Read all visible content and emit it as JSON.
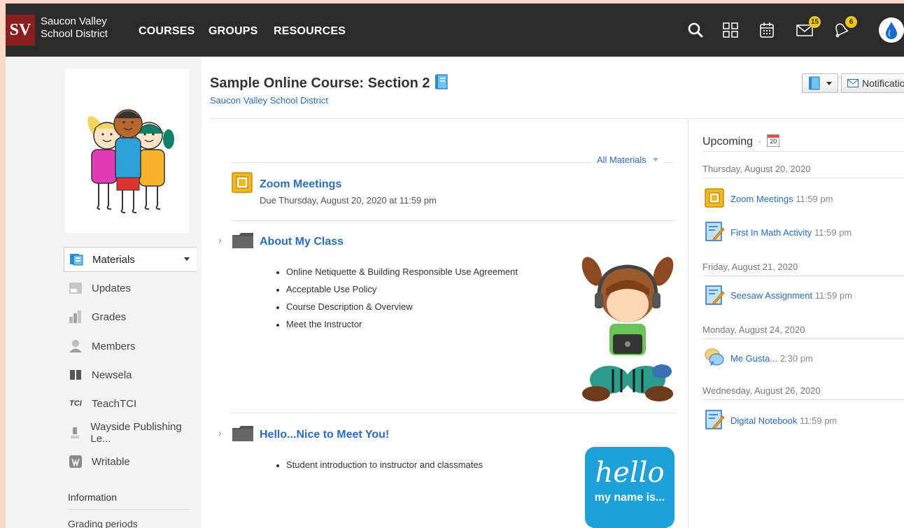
{
  "header": {
    "logo_text": "SV",
    "district_line1": "Saucon Valley",
    "district_line2": "School District",
    "nav": [
      "COURSES",
      "GROUPS",
      "RESOURCES"
    ],
    "messages_badge": "15",
    "notifications_badge": "6"
  },
  "sidebar": {
    "items": [
      {
        "label": "Materials",
        "icon": "materials-icon"
      },
      {
        "label": "Updates",
        "icon": "updates-icon"
      },
      {
        "label": "Grades",
        "icon": "grades-icon"
      },
      {
        "label": "Members",
        "icon": "members-icon"
      },
      {
        "label": "Newsela",
        "icon": "newsela-icon"
      },
      {
        "label": "TeachTCI",
        "icon": "tci-icon"
      },
      {
        "label": "Wayside Publishing Le...",
        "icon": "wayside-icon"
      },
      {
        "label": "Writable",
        "icon": "writable-icon"
      }
    ],
    "tci_badge": "TCI",
    "info_heading": "Information",
    "grading_periods": "Grading periods"
  },
  "course": {
    "title": "Sample Online Course: Section 2",
    "district": "Saucon Valley School District",
    "notifications_button": "Notificatio"
  },
  "materials": {
    "filter_label": "All Materials",
    "assignment": {
      "title": "Zoom Meetings",
      "due": "Due Thursday, August 20, 2020 at 11:59 pm"
    },
    "folders": [
      {
        "title": "About My Class",
        "bullets": [
          "Online Netiquette & Building Responsible Use Agreement",
          "Acceptable Use Policy",
          "Course Description & Overview",
          "Meet the Instructor"
        ]
      },
      {
        "title": "Hello...Nice to Meet You!",
        "bullets": [
          "Student introduction to instructor and classmates"
        ]
      }
    ],
    "hello_card_line1": "hello",
    "hello_card_line2": "my name is..."
  },
  "upcoming": {
    "heading": "Upcoming",
    "calendar_day": "20",
    "groups": [
      {
        "date": "Thursday, August 20, 2020",
        "events": [
          {
            "title": "Zoom Meetings",
            "time": "11:59 pm",
            "icon": "assignment-icon"
          },
          {
            "title": "First In Math Activity",
            "time": "11:59 pm",
            "icon": "assessment-icon"
          }
        ]
      },
      {
        "date": "Friday, August 21, 2020",
        "events": [
          {
            "title": "Seesaw Assignment",
            "time": "11:59 pm",
            "icon": "assessment-icon"
          }
        ]
      },
      {
        "date": "Monday, August 24, 2020",
        "events": [
          {
            "title": "Me Gusta...",
            "time": "2:30 pm",
            "icon": "discussion-icon"
          }
        ]
      },
      {
        "date": "Wednesday, August 26, 2020",
        "events": [
          {
            "title": "Digital Notebook",
            "time": "11:59 pm",
            "icon": "assessment-icon"
          }
        ]
      }
    ]
  },
  "colors": {
    "topbar": "#2b2b2b",
    "link": "#2a6ebb",
    "logo": "#8b1f1f",
    "badge": "#f2c31b",
    "page_border": "#fbd9c8"
  }
}
